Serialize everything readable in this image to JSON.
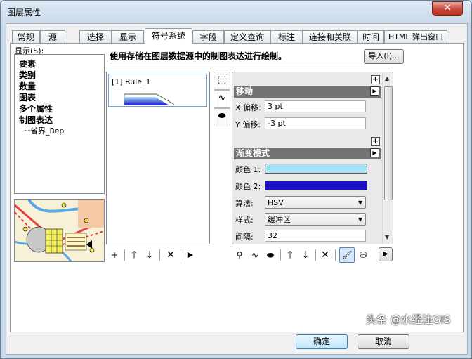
{
  "window": {
    "title": "图层属性",
    "close_symbol": "✕"
  },
  "tabs": [
    {
      "label": "常规"
    },
    {
      "label": "源"
    },
    {
      "label": "选择"
    },
    {
      "label": "显示"
    },
    {
      "label": "符号系统"
    },
    {
      "label": "字段"
    },
    {
      "label": "定义查询"
    },
    {
      "label": "标注"
    },
    {
      "label": "连接和关联"
    },
    {
      "label": "时间"
    },
    {
      "label": "HTML 弹出窗口"
    }
  ],
  "active_tab": "符号系统",
  "show_panel": {
    "label": "显示(S):",
    "items": [
      "要素",
      "类别",
      "数量",
      "图表",
      "多个属性",
      "制图表达"
    ],
    "subitem": "省界_Rep"
  },
  "description": "使用存储在图层数据源中的制图表达进行绘制。",
  "import_button": "导入(I)...",
  "rules": {
    "items": [
      {
        "label": "[1] Rule_1"
      }
    ]
  },
  "rule_tools": [
    "select-tool-icon",
    "line-symbol-icon",
    "polygon-symbol-icon"
  ],
  "effects": {
    "move": {
      "header": "移动",
      "x_label": "X 偏移:",
      "x_value": "3 pt",
      "y_label": "Y 偏移:",
      "y_value": "-3 pt"
    },
    "gradient": {
      "header": "渐变模式",
      "color1_label": "颜色 1:",
      "color1": "#a7e1f9",
      "color2_label": "颜色 2:",
      "color2": "#1d10c8",
      "algorithm_label": "算法:",
      "algorithm_value": "HSV",
      "style_label": "样式:",
      "style_value": "缓冲区",
      "interval_label": "间隔:",
      "interval_value": "32"
    },
    "plus_symbol": "+",
    "collapse_symbol": "▶"
  },
  "rules_toolbar": {
    "add": "+",
    "up": "🡑",
    "down": "🡓",
    "remove": "✕",
    "more": "▶"
  },
  "effects_toolbar": {
    "up": "🡑",
    "down": "🡓",
    "remove": "✕",
    "more": "▶"
  },
  "footer": {
    "ok": "确定",
    "cancel": "取消"
  },
  "watermark": "头条 @水经注GIS"
}
